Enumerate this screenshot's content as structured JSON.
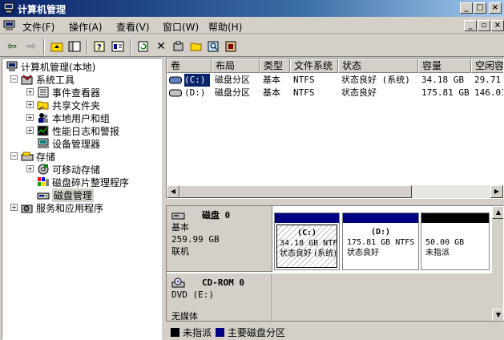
{
  "window": {
    "title": "计算机管理"
  },
  "menu": {
    "items": [
      "文件(F)",
      "操作(A)",
      "查看(V)",
      "窗口(W)",
      "帮助(H)"
    ]
  },
  "tree": {
    "root": "计算机管理(本地)",
    "system_tools": "系统工具",
    "event_viewer": "事件查看器",
    "shared_folders": "共享文件夹",
    "local_users": "本地用户和组",
    "perf_logs": "性能日志和警报",
    "device_manager": "设备管理器",
    "storage": "存储",
    "removable_storage": "可移动存储",
    "defrag": "磁盘碎片整理程序",
    "disk_mgmt": "磁盘管理",
    "services_apps": "服务和应用程序"
  },
  "volume_list": {
    "headers": [
      "卷",
      "布局",
      "类型",
      "文件系统",
      "状态",
      "容量",
      "空闲容"
    ],
    "rows": [
      {
        "volume": "(C:)",
        "layout": "磁盘分区",
        "type": "基本",
        "fs": "NTFS",
        "status": "状态良好 (系统)",
        "capacity": "34.18 GB",
        "free": "29.71 G"
      },
      {
        "volume": "(D:)",
        "layout": "磁盘分区",
        "type": "基本",
        "fs": "NTFS",
        "status": "状态良好",
        "capacity": "175.81 GB",
        "free": "146.01"
      }
    ]
  },
  "disks": {
    "disk0": {
      "name": "磁盘 0",
      "type": "基本",
      "size": "259.99 GB",
      "state": "联机",
      "partitions": [
        {
          "label": "(C:)",
          "size": "34.18 GB NTFS",
          "status": "状态良好 (系统)",
          "color": "#000080"
        },
        {
          "label": "(D:)",
          "size": "175.81 GB NTFS",
          "status": "状态良好",
          "color": "#000080"
        },
        {
          "label": "",
          "size": "50.00 GB",
          "status": "未指派",
          "color": "#000000"
        }
      ]
    },
    "cdrom0": {
      "name": "CD-ROM 0",
      "drive": "DVD (E:)",
      "media": "无媒体"
    }
  },
  "legend": {
    "unallocated": "未指派",
    "primary": "主要磁盘分区",
    "unallocated_color": "#000000",
    "primary_color": "#000080"
  }
}
